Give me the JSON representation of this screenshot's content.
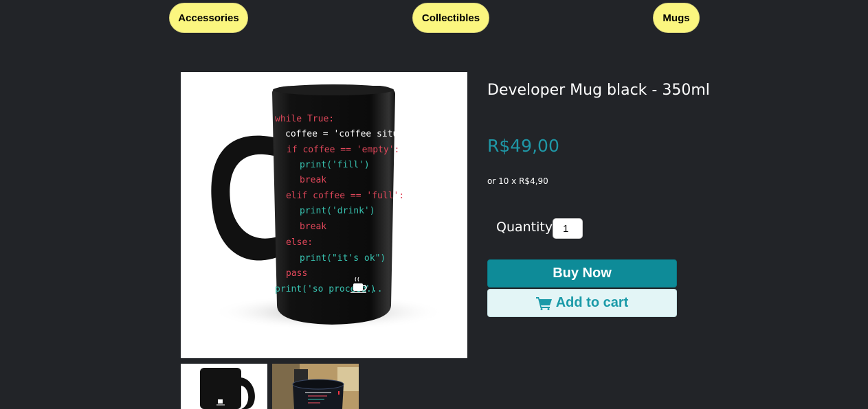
{
  "nav": {
    "categories": [
      "Accessories",
      "Collectibles",
      "Mugs"
    ]
  },
  "product": {
    "title": "Developer Mug black - 350ml",
    "price": "R$49,00",
    "installments": "or 10 x R$4,90",
    "quantity_label": "Quantity:",
    "quantity_value": "1",
    "buy_now_label": "Buy Now",
    "add_to_cart_label": "Add to cart",
    "image": {
      "icon": "mug-image",
      "code_lines": [
        "while True:",
        "coffee = 'coffee situation,'",
        "if coffee == 'empty':",
        "print('fill')",
        "break",
        "elif coffee == 'full':",
        "print('drink')",
        "break",
        "else:",
        "print(\"it's ok\")",
        "pass",
        "print('so proceed...",
        "')"
      ]
    },
    "thumbnails": [
      "mug-thumbnail",
      "mug-photo-thumbnail"
    ]
  },
  "colors": {
    "background": "#222428",
    "nav_pill": "#fbf67f",
    "price": "#1f97a6",
    "buy_now": "#0e8b98",
    "add_to_cart_bg": "#e3f5f6",
    "add_to_cart_text": "#1a9aa8"
  },
  "icons": {
    "cart": "shopping-cart-icon"
  }
}
